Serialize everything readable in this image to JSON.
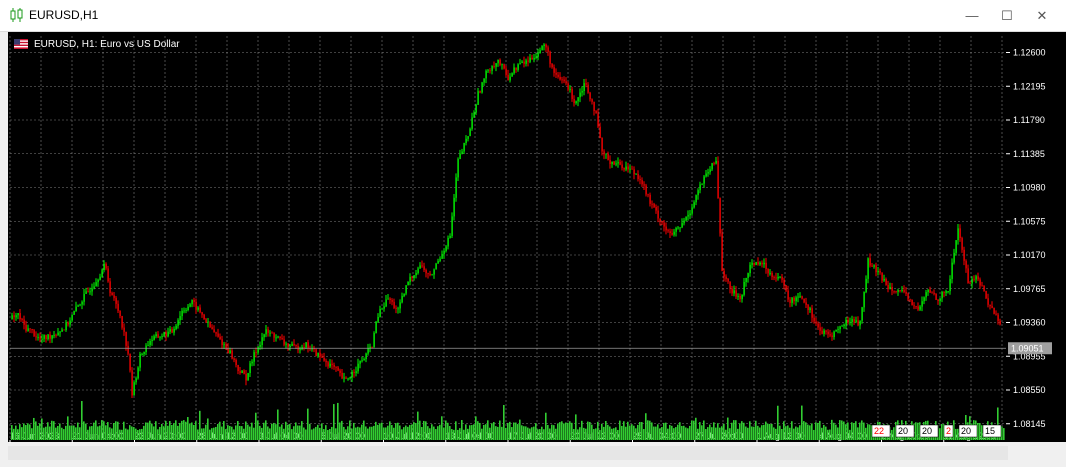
{
  "window": {
    "title": "EURUSD,H1",
    "icon": "candlestick-chart-icon",
    "controls": {
      "minimize": "—",
      "maximize": "☐",
      "close": "✕"
    }
  },
  "chart": {
    "header": "EURUSD, H1:  Euro vs US Dollar",
    "flag_icon": "us-flag-icon",
    "current_price": "1.09051",
    "colors": {
      "background": "#000000",
      "bull": "#00ff00",
      "bear": "#ff0000",
      "grid": "#808080",
      "volume": "#32cd32",
      "text": "#ffffff"
    },
    "price_labels": [
      "1.12600",
      "1.12195",
      "1.11790",
      "1.11385",
      "1.10980",
      "1.10575",
      "1.10170",
      "1.09765",
      "1.09360",
      "1.08955",
      "1.08550",
      "1.08145"
    ],
    "time_labels": [
      "16 Jun 2023",
      "21 Jun 04:00",
      "23 Jun 20:00",
      "28 Jun 12:00",
      "3 Jul 04:00",
      "5 Jul 20:00",
      "10 Jul 12:00",
      "13 Jul 04:00",
      "17 Jul 20:00",
      "20 Jul 12:00",
      "25 Jul 04:00",
      "27 Jul 20:00",
      "1 Aug 12:00",
      "4 Aug 04:00",
      "8 Aug 20:00",
      "11 Aug 12:00"
    ],
    "volume_markers": [
      "22",
      "20",
      "20",
      "2",
      "20",
      "15"
    ]
  },
  "chart_data": {
    "type": "candlestick",
    "symbol": "EURUSD",
    "timeframe": "H1",
    "ylim": [
      1.0795,
      1.1275
    ],
    "close_path": [
      [
        0,
        1.094
      ],
      [
        8,
        1.0945
      ],
      [
        15,
        1.093
      ],
      [
        22,
        1.0925
      ],
      [
        30,
        1.0915
      ],
      [
        40,
        1.092
      ],
      [
        55,
        1.093
      ],
      [
        70,
        1.096
      ],
      [
        85,
        1.0985
      ],
      [
        95,
        1.1005
      ],
      [
        100,
        1.0975
      ],
      [
        110,
        1.0945
      ],
      [
        118,
        1.09
      ],
      [
        122,
        1.085
      ],
      [
        130,
        1.0895
      ],
      [
        140,
        1.0915
      ],
      [
        150,
        1.092
      ],
      [
        162,
        1.0925
      ],
      [
        172,
        1.095
      ],
      [
        182,
        1.096
      ],
      [
        192,
        1.0945
      ],
      [
        200,
        1.093
      ],
      [
        210,
        1.0915
      ],
      [
        220,
        1.09
      ],
      [
        228,
        1.088
      ],
      [
        236,
        1.087
      ],
      [
        245,
        1.09
      ],
      [
        255,
        1.0925
      ],
      [
        265,
        1.092
      ],
      [
        275,
        1.091
      ],
      [
        285,
        1.0905
      ],
      [
        295,
        1.091
      ],
      [
        305,
        1.09
      ],
      [
        315,
        1.089
      ],
      [
        325,
        1.088
      ],
      [
        335,
        1.0865
      ],
      [
        345,
        1.088
      ],
      [
        355,
        1.0895
      ],
      [
        362,
        1.091
      ],
      [
        368,
        1.0945
      ],
      [
        378,
        1.0965
      ],
      [
        388,
        1.095
      ],
      [
        398,
        1.0985
      ],
      [
        410,
        1.1005
      ],
      [
        420,
        1.099
      ],
      [
        430,
        1.1015
      ],
      [
        440,
        1.104
      ],
      [
        448,
        1.113
      ],
      [
        458,
        1.116
      ],
      [
        468,
        1.121
      ],
      [
        478,
        1.124
      ],
      [
        488,
        1.125
      ],
      [
        498,
        1.123
      ],
      [
        508,
        1.1245
      ],
      [
        518,
        1.125
      ],
      [
        528,
        1.126
      ],
      [
        535,
        1.127
      ],
      [
        545,
        1.123
      ],
      [
        555,
        1.1225
      ],
      [
        565,
        1.12
      ],
      [
        575,
        1.1225
      ],
      [
        585,
        1.119
      ],
      [
        592,
        1.114
      ],
      [
        600,
        1.113
      ],
      [
        610,
        1.1125
      ],
      [
        620,
        1.112
      ],
      [
        630,
        1.111
      ],
      [
        640,
        1.108
      ],
      [
        650,
        1.106
      ],
      [
        660,
        1.104
      ],
      [
        670,
        1.105
      ],
      [
        680,
        1.107
      ],
      [
        690,
        1.11
      ],
      [
        700,
        1.112
      ],
      [
        706,
        1.113
      ],
      [
        712,
        1.1
      ],
      [
        720,
        1.0975
      ],
      [
        730,
        1.0965
      ],
      [
        740,
        1.1005
      ],
      [
        750,
        1.101
      ],
      [
        760,
        1.0995
      ],
      [
        770,
        1.099
      ],
      [
        780,
        1.096
      ],
      [
        790,
        1.097
      ],
      [
        800,
        1.095
      ],
      [
        810,
        1.0925
      ],
      [
        820,
        1.092
      ],
      [
        830,
        1.093
      ],
      [
        840,
        1.094
      ],
      [
        850,
        1.0935
      ],
      [
        858,
        1.101
      ],
      [
        868,
        1.0995
      ],
      [
        878,
        1.098
      ],
      [
        888,
        1.0975
      ],
      [
        898,
        1.0965
      ],
      [
        908,
        1.095
      ],
      [
        918,
        1.0975
      ],
      [
        928,
        1.0965
      ],
      [
        938,
        1.0975
      ],
      [
        948,
        1.105
      ],
      [
        958,
        1.0985
      ],
      [
        968,
        1.099
      ],
      [
        978,
        1.096
      ],
      [
        988,
        1.094
      ],
      [
        995,
        1.092
      ],
      [
        1000,
        1.0905
      ]
    ]
  }
}
